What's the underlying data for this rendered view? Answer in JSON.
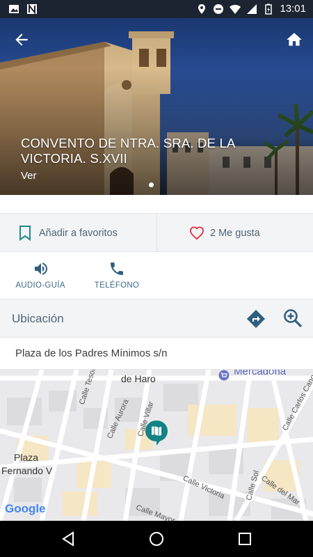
{
  "status_bar": {
    "time": "13:01",
    "left_icons": [
      "image-icon",
      "n-app-icon"
    ],
    "right_icons": [
      "location-icon",
      "do-not-disturb-icon",
      "wifi-icon",
      "signal-icon",
      "battery-icon"
    ]
  },
  "hero": {
    "title": "CONVENTO DE NTRA. SRA. DE LA VICTORIA. S.XVII",
    "link": "Ver",
    "page_count": 1,
    "active_page": 1
  },
  "actions": {
    "favorite_label": "Añadir a favoritos",
    "like_label": "2 Me gusta"
  },
  "quick_buttons": {
    "audio_label": "AUDIO-GUÍA",
    "phone_label": "TELÉFONO"
  },
  "location": {
    "title": "Ubicación",
    "address": "Plaza de los Padres Mínimos s/n"
  },
  "map": {
    "labels": {
      "mercadona": "Mercadona",
      "de_haro": "de Haro",
      "tesoro": "Calle Tesoro",
      "aurora": "Calle Aurora",
      "villar": "Calle Villar",
      "carlos_cano": "Calle Carlos Cano",
      "plaza": "Plaza",
      "fernando": "Fernando V",
      "victoria": "Calle Victoria",
      "sol": "Calle Sol",
      "del_mar": "Calle del Mar",
      "mayor": "Calle Mayor"
    },
    "attribution": "Google"
  },
  "colors": {
    "accent_teal": "#1d8a8f",
    "label_blue": "#4f6676",
    "heart_red": "#e0313f",
    "map_pin": "#138388"
  }
}
